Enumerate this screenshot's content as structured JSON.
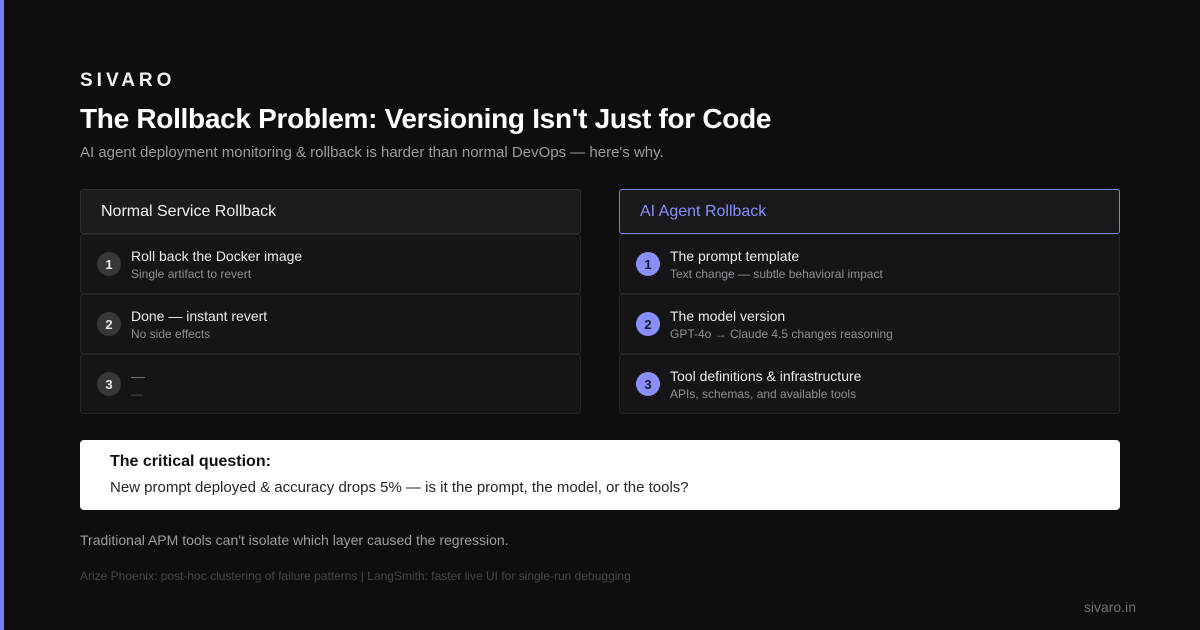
{
  "brand": "SIVARO",
  "title": "The Rollback Problem: Versioning Isn't Just for Code",
  "subtitle": "AI agent deployment monitoring & rollback is harder than normal DevOps — here's why.",
  "colors": {
    "accent": "#7b7ff5",
    "background": "#0e0e10"
  },
  "left_column": {
    "header": "Normal Service Rollback",
    "steps": [
      {
        "num": "1",
        "title": "Roll back the Docker image",
        "sub": "Single artifact to revert"
      },
      {
        "num": "2",
        "title": "Done — instant revert",
        "sub": "No side effects"
      },
      {
        "num": "3",
        "title": "—",
        "sub": "—"
      }
    ]
  },
  "right_column": {
    "header": "AI Agent Rollback",
    "steps": [
      {
        "num": "1",
        "title": "The prompt template",
        "sub": "Text change — subtle behavioral impact"
      },
      {
        "num": "2",
        "title": "The model version",
        "sub": "GPT-4o → Claude 4.5 changes reasoning"
      },
      {
        "num": "3",
        "title": "Tool definitions & infrastructure",
        "sub": "APIs, schemas, and available tools"
      }
    ]
  },
  "callout": {
    "title": "The critical question:",
    "body": "New prompt deployed & accuracy drops 5% — is it the prompt, the model, or the tools?"
  },
  "note": "Traditional APM tools can't isolate which layer caused the regression.",
  "footnote": "Arize Phoenix: post-hoc clustering of failure patterns | LangSmith: faster live UI for single-run debugging",
  "site": "sivaro.in"
}
